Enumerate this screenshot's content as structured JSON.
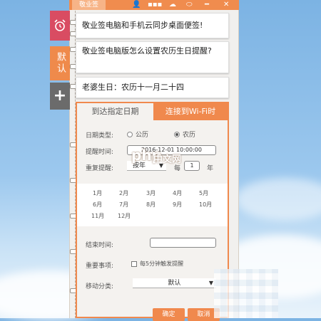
{
  "window": {
    "tab_label": "敬业签",
    "icons": [
      "user-icon",
      "grid-icon",
      "cloud-icon",
      "toggle-icon",
      "minus-icon",
      "close-icon"
    ]
  },
  "sidebar": {
    "alarm_icon": "alarm-clock-icon",
    "default_label": "默认",
    "add_label": "+"
  },
  "notes": [
    {
      "text": "敬业签电脑和手机云同步桌面便签!"
    },
    {
      "text": "敬业签电脑版怎么设置农历生日提醒?"
    },
    {
      "text": "老婆生日：农历十一月二十四"
    }
  ],
  "reminder_panel": {
    "tabs": [
      "到达指定日期",
      "连接到Wi-Fi时"
    ],
    "date_type_label": "日期类型:",
    "date_type_options": [
      "公历",
      "农历"
    ],
    "date_type_selected": "农历",
    "remind_time_label": "提醒时间:",
    "remind_time_value": "2016-12-01 10:00:00",
    "repeat_label": "重复提醒:",
    "repeat_mode": "按年",
    "every_label": "每",
    "every_value": "1",
    "every_unit": "年",
    "months": [
      "1月",
      "2月",
      "3月",
      "4月",
      "5月",
      "6月",
      "7月",
      "8月",
      "9月",
      "10月",
      "11月",
      "12月"
    ],
    "end_time_label": "结束时间:",
    "end_time_value": "",
    "repeat_items_label": "重要事项:",
    "repeat_items_checkbox": "每5分钟触发提醒",
    "move_category_label": "移动分类:",
    "move_category_value": "默认",
    "confirm_label": "确定",
    "cancel_label": "取消"
  },
  "watermark": {
    "text1": "php",
    "text2": "中文网"
  }
}
